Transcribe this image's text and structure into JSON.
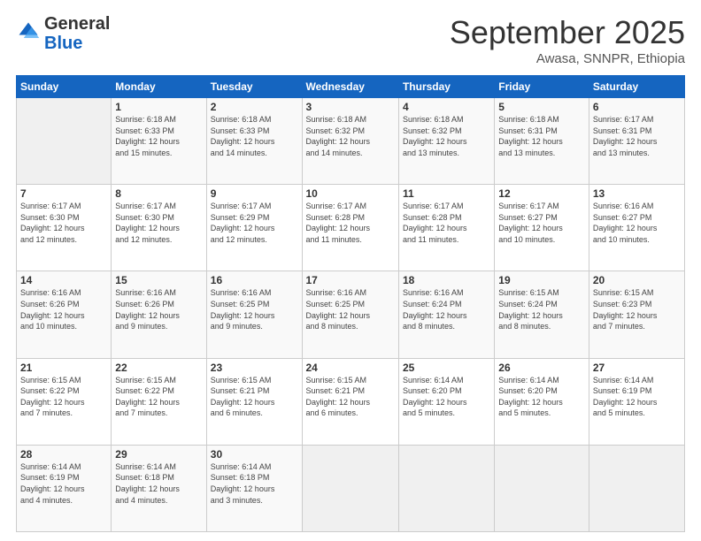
{
  "logo": {
    "line1": "General",
    "line2": "Blue"
  },
  "header": {
    "month": "September 2025",
    "location": "Awasa, SNNPR, Ethiopia"
  },
  "weekdays": [
    "Sunday",
    "Monday",
    "Tuesday",
    "Wednesday",
    "Thursday",
    "Friday",
    "Saturday"
  ],
  "weeks": [
    [
      {
        "day": "",
        "info": ""
      },
      {
        "day": "1",
        "info": "Sunrise: 6:18 AM\nSunset: 6:33 PM\nDaylight: 12 hours\nand 15 minutes."
      },
      {
        "day": "2",
        "info": "Sunrise: 6:18 AM\nSunset: 6:33 PM\nDaylight: 12 hours\nand 14 minutes."
      },
      {
        "day": "3",
        "info": "Sunrise: 6:18 AM\nSunset: 6:32 PM\nDaylight: 12 hours\nand 14 minutes."
      },
      {
        "day": "4",
        "info": "Sunrise: 6:18 AM\nSunset: 6:32 PM\nDaylight: 12 hours\nand 13 minutes."
      },
      {
        "day": "5",
        "info": "Sunrise: 6:18 AM\nSunset: 6:31 PM\nDaylight: 12 hours\nand 13 minutes."
      },
      {
        "day": "6",
        "info": "Sunrise: 6:17 AM\nSunset: 6:31 PM\nDaylight: 12 hours\nand 13 minutes."
      }
    ],
    [
      {
        "day": "7",
        "info": "Sunrise: 6:17 AM\nSunset: 6:30 PM\nDaylight: 12 hours\nand 12 minutes."
      },
      {
        "day": "8",
        "info": "Sunrise: 6:17 AM\nSunset: 6:30 PM\nDaylight: 12 hours\nand 12 minutes."
      },
      {
        "day": "9",
        "info": "Sunrise: 6:17 AM\nSunset: 6:29 PM\nDaylight: 12 hours\nand 12 minutes."
      },
      {
        "day": "10",
        "info": "Sunrise: 6:17 AM\nSunset: 6:28 PM\nDaylight: 12 hours\nand 11 minutes."
      },
      {
        "day": "11",
        "info": "Sunrise: 6:17 AM\nSunset: 6:28 PM\nDaylight: 12 hours\nand 11 minutes."
      },
      {
        "day": "12",
        "info": "Sunrise: 6:17 AM\nSunset: 6:27 PM\nDaylight: 12 hours\nand 10 minutes."
      },
      {
        "day": "13",
        "info": "Sunrise: 6:16 AM\nSunset: 6:27 PM\nDaylight: 12 hours\nand 10 minutes."
      }
    ],
    [
      {
        "day": "14",
        "info": "Sunrise: 6:16 AM\nSunset: 6:26 PM\nDaylight: 12 hours\nand 10 minutes."
      },
      {
        "day": "15",
        "info": "Sunrise: 6:16 AM\nSunset: 6:26 PM\nDaylight: 12 hours\nand 9 minutes."
      },
      {
        "day": "16",
        "info": "Sunrise: 6:16 AM\nSunset: 6:25 PM\nDaylight: 12 hours\nand 9 minutes."
      },
      {
        "day": "17",
        "info": "Sunrise: 6:16 AM\nSunset: 6:25 PM\nDaylight: 12 hours\nand 8 minutes."
      },
      {
        "day": "18",
        "info": "Sunrise: 6:16 AM\nSunset: 6:24 PM\nDaylight: 12 hours\nand 8 minutes."
      },
      {
        "day": "19",
        "info": "Sunrise: 6:15 AM\nSunset: 6:24 PM\nDaylight: 12 hours\nand 8 minutes."
      },
      {
        "day": "20",
        "info": "Sunrise: 6:15 AM\nSunset: 6:23 PM\nDaylight: 12 hours\nand 7 minutes."
      }
    ],
    [
      {
        "day": "21",
        "info": "Sunrise: 6:15 AM\nSunset: 6:22 PM\nDaylight: 12 hours\nand 7 minutes."
      },
      {
        "day": "22",
        "info": "Sunrise: 6:15 AM\nSunset: 6:22 PM\nDaylight: 12 hours\nand 7 minutes."
      },
      {
        "day": "23",
        "info": "Sunrise: 6:15 AM\nSunset: 6:21 PM\nDaylight: 12 hours\nand 6 minutes."
      },
      {
        "day": "24",
        "info": "Sunrise: 6:15 AM\nSunset: 6:21 PM\nDaylight: 12 hours\nand 6 minutes."
      },
      {
        "day": "25",
        "info": "Sunrise: 6:14 AM\nSunset: 6:20 PM\nDaylight: 12 hours\nand 5 minutes."
      },
      {
        "day": "26",
        "info": "Sunrise: 6:14 AM\nSunset: 6:20 PM\nDaylight: 12 hours\nand 5 minutes."
      },
      {
        "day": "27",
        "info": "Sunrise: 6:14 AM\nSunset: 6:19 PM\nDaylight: 12 hours\nand 5 minutes."
      }
    ],
    [
      {
        "day": "28",
        "info": "Sunrise: 6:14 AM\nSunset: 6:19 PM\nDaylight: 12 hours\nand 4 minutes."
      },
      {
        "day": "29",
        "info": "Sunrise: 6:14 AM\nSunset: 6:18 PM\nDaylight: 12 hours\nand 4 minutes."
      },
      {
        "day": "30",
        "info": "Sunrise: 6:14 AM\nSunset: 6:18 PM\nDaylight: 12 hours\nand 3 minutes."
      },
      {
        "day": "",
        "info": ""
      },
      {
        "day": "",
        "info": ""
      },
      {
        "day": "",
        "info": ""
      },
      {
        "day": "",
        "info": ""
      }
    ]
  ]
}
